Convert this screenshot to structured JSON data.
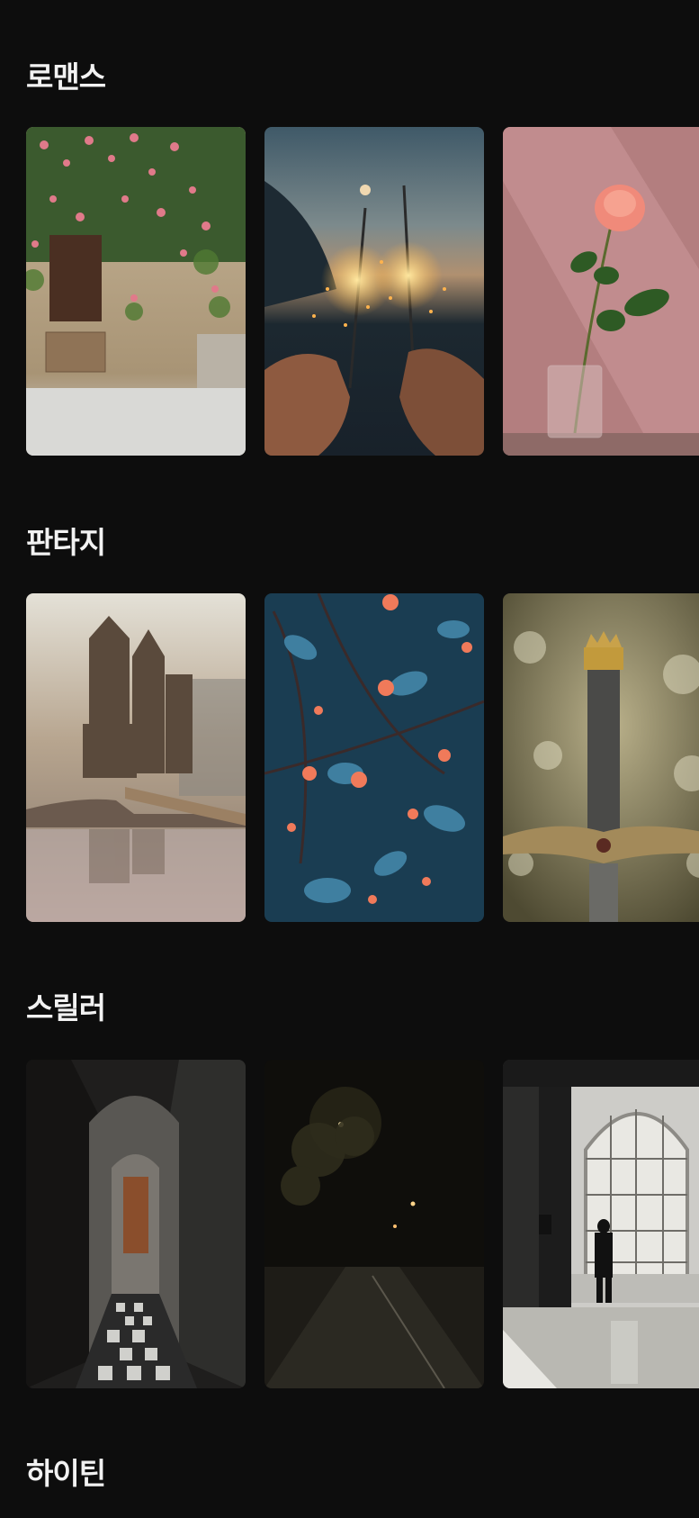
{
  "sections": [
    {
      "title": "로맨스",
      "cards": [
        {
          "icon": "rose-arch-building-photo"
        },
        {
          "icon": "sparklers-photo"
        },
        {
          "icon": "rose-in-vase-photo"
        }
      ]
    },
    {
      "title": "판타지",
      "cards": [
        {
          "icon": "castle-photo"
        },
        {
          "icon": "blue-leaves-red-berries-photo"
        },
        {
          "icon": "sword-with-crown-photo"
        }
      ]
    },
    {
      "title": "스릴러",
      "cards": [
        {
          "icon": "dark-corridor-photo"
        },
        {
          "icon": "night-street-photo"
        },
        {
          "icon": "man-at-window-photo"
        }
      ]
    },
    {
      "title": "하이틴",
      "cards": []
    }
  ],
  "colors": {
    "background": "#0d0d0d",
    "title_text": "#f2f2f2"
  }
}
